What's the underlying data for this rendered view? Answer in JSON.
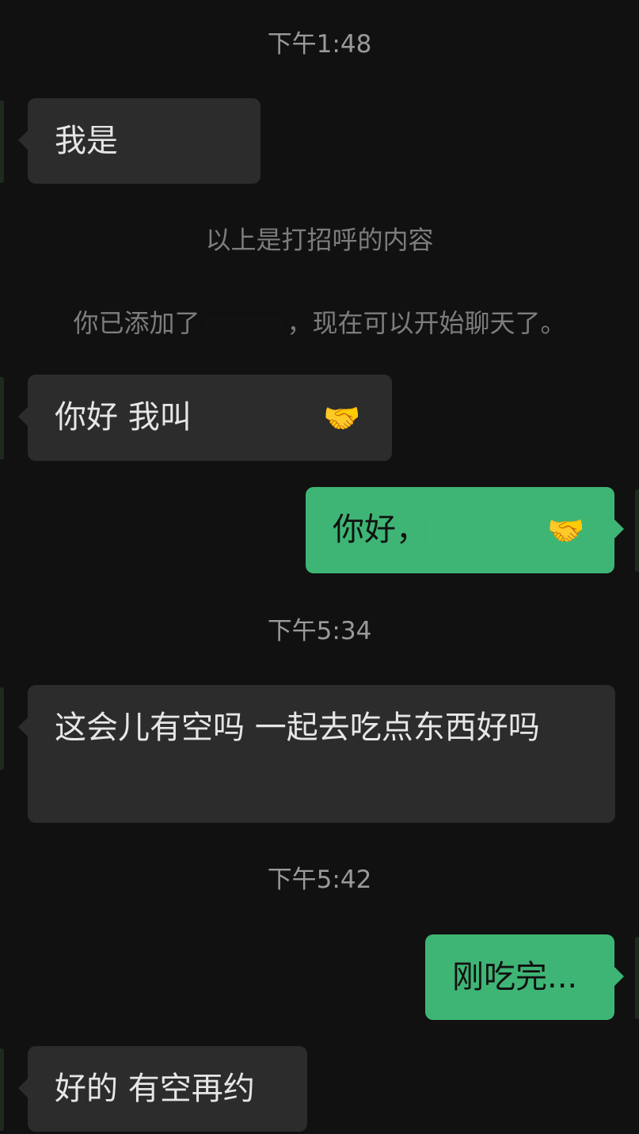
{
  "timestamps": [
    "下午1:48",
    "下午5:34",
    "下午5:42"
  ],
  "system": {
    "greeting_note": "以上是打招呼的内容",
    "added_prefix": "你已添加了",
    "added_suffix": "，现在可以开始聊天了。"
  },
  "messages": [
    {
      "side": "incoming",
      "text": "我是"
    },
    {
      "side": "incoming",
      "text": "你好 我叫",
      "emoji": "🤝"
    },
    {
      "side": "outgoing",
      "text": "你好，",
      "emoji": "🤝"
    },
    {
      "side": "incoming",
      "text": "这会儿有空吗 一起去吃点东西好吗"
    },
    {
      "side": "outgoing",
      "text": "刚吃完..."
    },
    {
      "side": "incoming",
      "text": "好的 有空再约"
    }
  ],
  "colors": {
    "background": "#111111",
    "incoming_bubble": "#2c2c2c",
    "outgoing_bubble": "#3eb575"
  }
}
